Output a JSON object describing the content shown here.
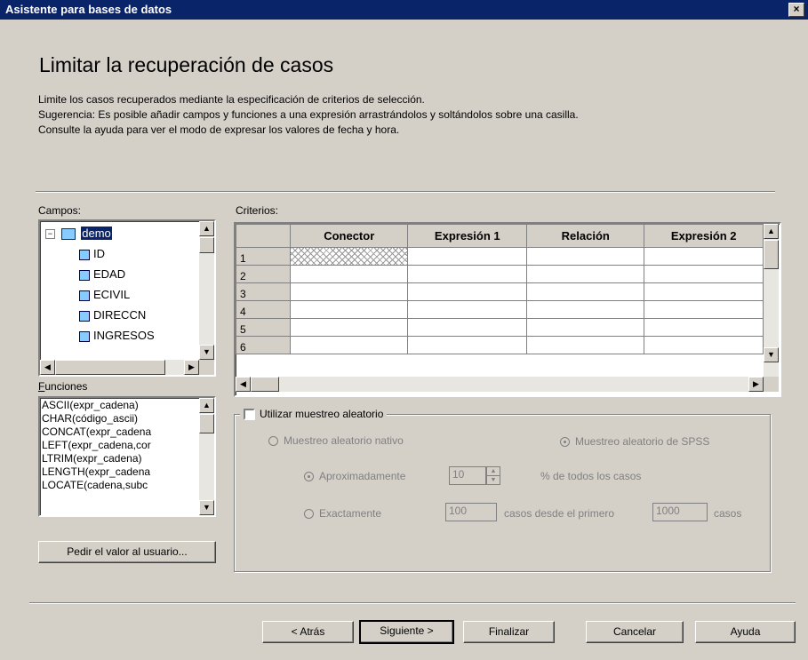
{
  "window": {
    "title": "Asistente para bases de datos",
    "close_glyph": "×"
  },
  "page": {
    "heading": "Limitar la recuperación de casos",
    "desc": [
      "Limite los casos recuperados mediante la especificación de criterios de selección.",
      "Sugerencia: Es posible añadir campos y funciones a una expresión arrastrándolos y soltándolos sobre una casilla.",
      "Consulte la ayuda para ver el modo de expresar los valores de fecha y hora."
    ]
  },
  "fields": {
    "label": "Campos:",
    "root": "demo",
    "items": [
      "ID",
      "EDAD",
      "ECIVIL",
      "DIRECCN",
      "INGRESOS"
    ]
  },
  "functions": {
    "label": "Funciones",
    "items": [
      "ASCII(expr_cadena)",
      "CHAR(código_ascii)",
      "CONCAT(expr_cadena",
      "LEFT(expr_cadena,cor",
      "LTRIM(expr_cadena)",
      "LENGTH(expr_cadena",
      "LOCATE(cadena,subc"
    ]
  },
  "criteria": {
    "label": "Criterios:",
    "columns": [
      "Conector",
      "Expresión 1",
      "Relación",
      "Expresión 2"
    ],
    "rows": [
      "1",
      "2",
      "3",
      "4",
      "5",
      "6"
    ]
  },
  "random": {
    "checkbox_label": "Utilizar muestreo aleatorio",
    "native_label": "Muestreo aleatorio nativo",
    "spss_label": "Muestreo aleatorio de SPSS",
    "approx_label": "Aproximadamente",
    "approx_value": "10",
    "approx_suffix": "% de todos los casos",
    "exact_label": "Exactamente",
    "exact_value": "100",
    "exact_middle": "casos desde el primero",
    "exact_first": "1000",
    "exact_suffix": "casos"
  },
  "buttons": {
    "prompt": "Pedir el valor al usuario...",
    "back": "< Atrás",
    "next": "Siguiente >",
    "finish": "Finalizar",
    "cancel": "Cancelar",
    "help": "Ayuda"
  }
}
